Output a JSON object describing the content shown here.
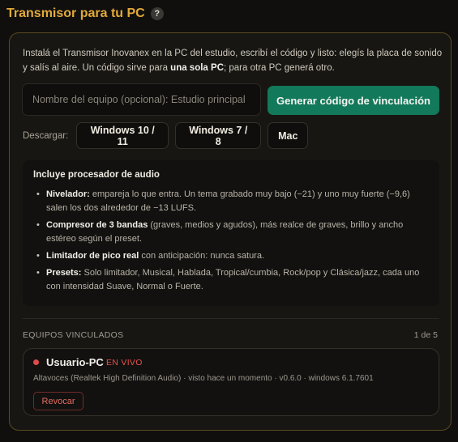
{
  "header": {
    "title": "Transmisor para tu PC",
    "help_icon_glyph": "?",
    "help_icon": "question-mark-icon"
  },
  "intro": {
    "text_1": "Instalá el Transmisor Inovanex en la PC del estudio, escribí el código y listo: elegís la placa de sonido y salís al aire. Un código sirve para ",
    "bold": "una sola PC",
    "text_2": "; para otra PC generá otro."
  },
  "pairing": {
    "name_placeholder": "Nombre del equipo (opcional): Estudio principal",
    "name_value": "",
    "generate_label": "Generar código de vinculación"
  },
  "download": {
    "label": "Descargar:",
    "options": [
      "Windows 10 / 11",
      "Windows 7 / 8",
      "Mac"
    ]
  },
  "audio": {
    "title": "Incluye procesador de audio",
    "items": [
      {
        "bold": "Nivelador:",
        "text": " empareja lo que entra. Un tema grabado muy bajo (−21) y uno muy fuerte (−9,6) salen los dos alrededor de −13 LUFS."
      },
      {
        "bold": "Compresor de 3 bandas",
        "text": " (graves, medios y agudos), más realce de graves, brillo y ancho estéreo según el preset."
      },
      {
        "bold": "Limitador de pico real",
        "text": " con anticipación: nunca satura."
      },
      {
        "bold": "Presets:",
        "text": " Solo limitador, Musical, Hablada, Tropical/cumbia, Rock/pop y Clásica/jazz, cada uno con intensidad Suave, Normal o Fuerte."
      }
    ]
  },
  "linked": {
    "label": "EQUIPOS VINCULADOS",
    "count": "1 de 5",
    "devices": [
      {
        "name": "Usuario-PC",
        "status": "EN VIVO",
        "status_color": "#e04a4a",
        "info": "Altavoces (Realtek High Definition Audio) · visto hace un momento · v0.6.0 · windows 6.1.7601",
        "revoke_label": "Revocar"
      }
    ]
  },
  "colors": {
    "accent": "#e2a93a",
    "primary_button": "#12795a",
    "danger": "#e46c62"
  }
}
